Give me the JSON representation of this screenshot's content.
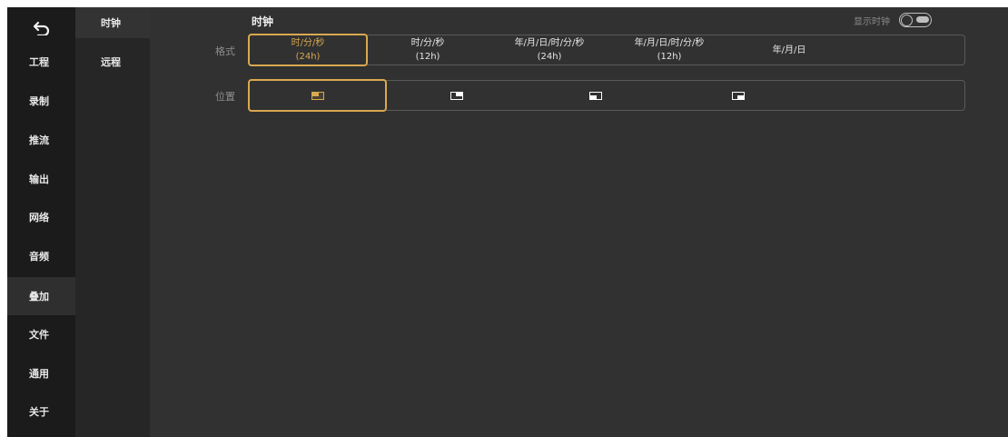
{
  "nav": {
    "back_icon": "undo-arrow-icon",
    "items": [
      {
        "label": "工程"
      },
      {
        "label": "录制"
      },
      {
        "label": "推流"
      },
      {
        "label": "输出"
      },
      {
        "label": "网络"
      },
      {
        "label": "音频"
      },
      {
        "label": "叠加"
      },
      {
        "label": "文件"
      },
      {
        "label": "通用"
      },
      {
        "label": "关于"
      }
    ],
    "active": "叠加"
  },
  "subnav": {
    "items": [
      {
        "label": "时钟"
      },
      {
        "label": "远程"
      }
    ],
    "active": "时钟"
  },
  "main": {
    "title": "时钟",
    "show_clock_label": "显示时钟",
    "show_clock_enabled": false,
    "format": {
      "label": "格式",
      "options": [
        {
          "line1": "时/分/秒",
          "line2": "(24h)"
        },
        {
          "line1": "时/分/秒",
          "line2": "(12h)"
        },
        {
          "line1": "年/月/日/时/分/秒",
          "line2": "(24h)"
        },
        {
          "line1": "年/月/日/时/分/秒",
          "line2": "(12h)"
        },
        {
          "line1": "年/月/日",
          "line2": ""
        }
      ],
      "selected_index": 0
    },
    "position": {
      "label": "位置",
      "options": [
        {
          "icon": "position-top-left-icon"
        },
        {
          "icon": "position-top-right-icon"
        },
        {
          "icon": "position-bottom-left-icon"
        },
        {
          "icon": "position-bottom-right-icon"
        }
      ],
      "selected_index": 0
    }
  },
  "colors": {
    "accent": "#d9a94f",
    "nav_bg": "#1b1b1b",
    "subnav_bg": "#262626",
    "main_bg": "#313131"
  }
}
